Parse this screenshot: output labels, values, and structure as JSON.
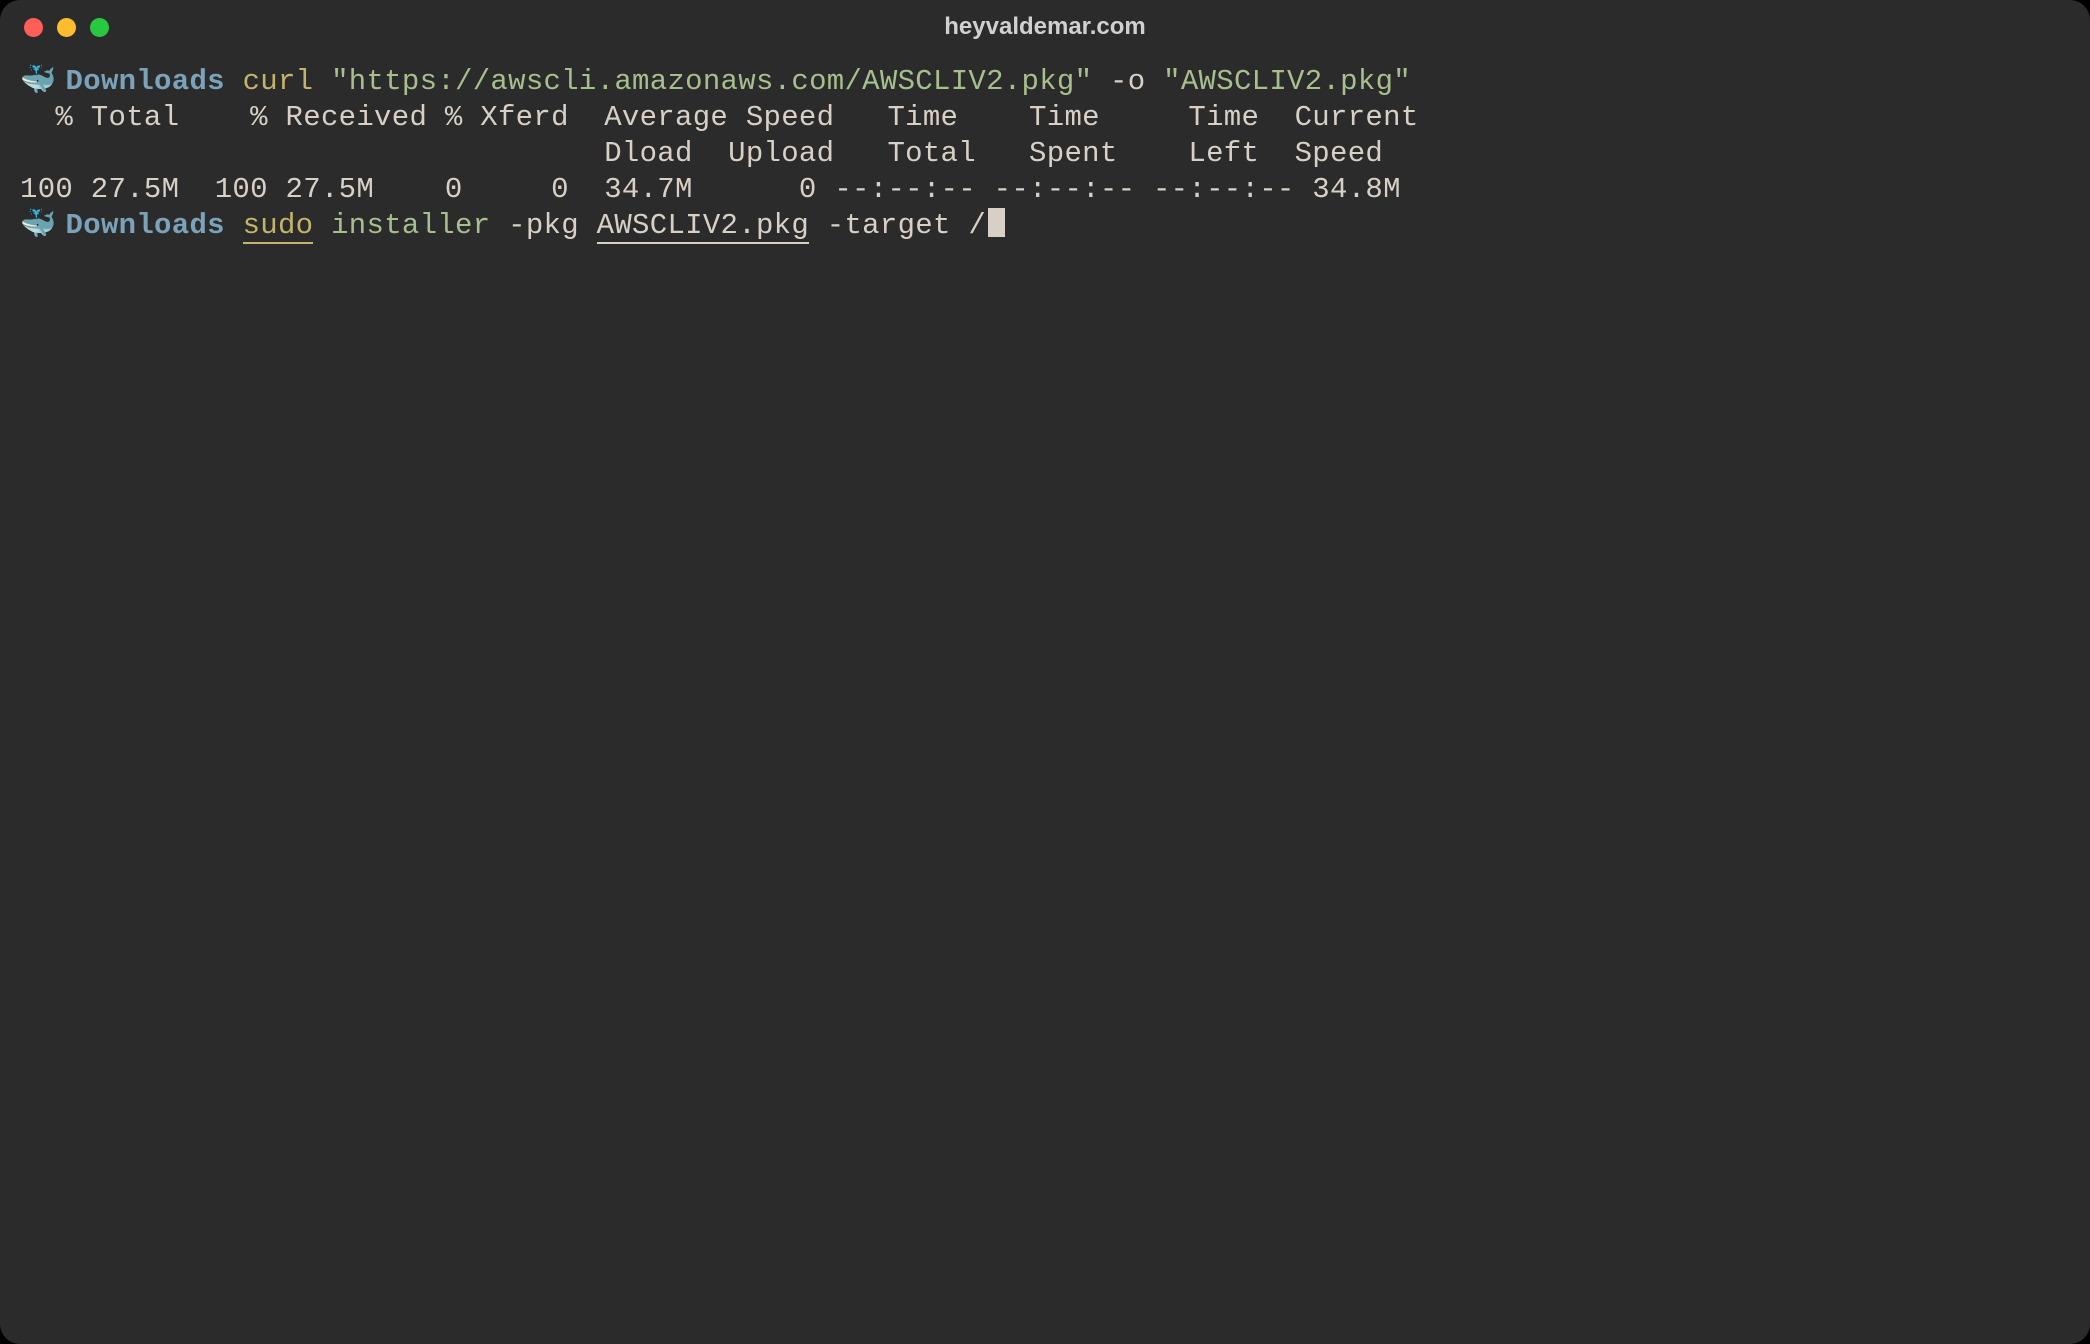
{
  "window": {
    "title": "heyvaldemar.com"
  },
  "prompt": {
    "emoji": "🐳",
    "dir": "Downloads"
  },
  "line1": {
    "cmd": "curl",
    "url": "\"https://awscli.amazonaws.com/AWSCLIV2.pkg\"",
    "flag": "-o",
    "out": "\"AWSCLIV2.pkg\""
  },
  "curl_output": {
    "h1": "  % Total    % Received % Xferd  Average Speed   Time    Time     Time  Current",
    "h2": "                                 Dload  Upload   Total   Spent    Left  Speed",
    "r1": "100 27.5M  100 27.5M    0     0  34.7M      0 --:--:-- --:--:-- --:--:-- 34.8M"
  },
  "line2": {
    "sudo": "sudo",
    "installer": "installer",
    "pkg_flag": "-pkg",
    "pkg": "AWSCLIV2.pkg",
    "target_flag": "-target",
    "target": "/"
  }
}
